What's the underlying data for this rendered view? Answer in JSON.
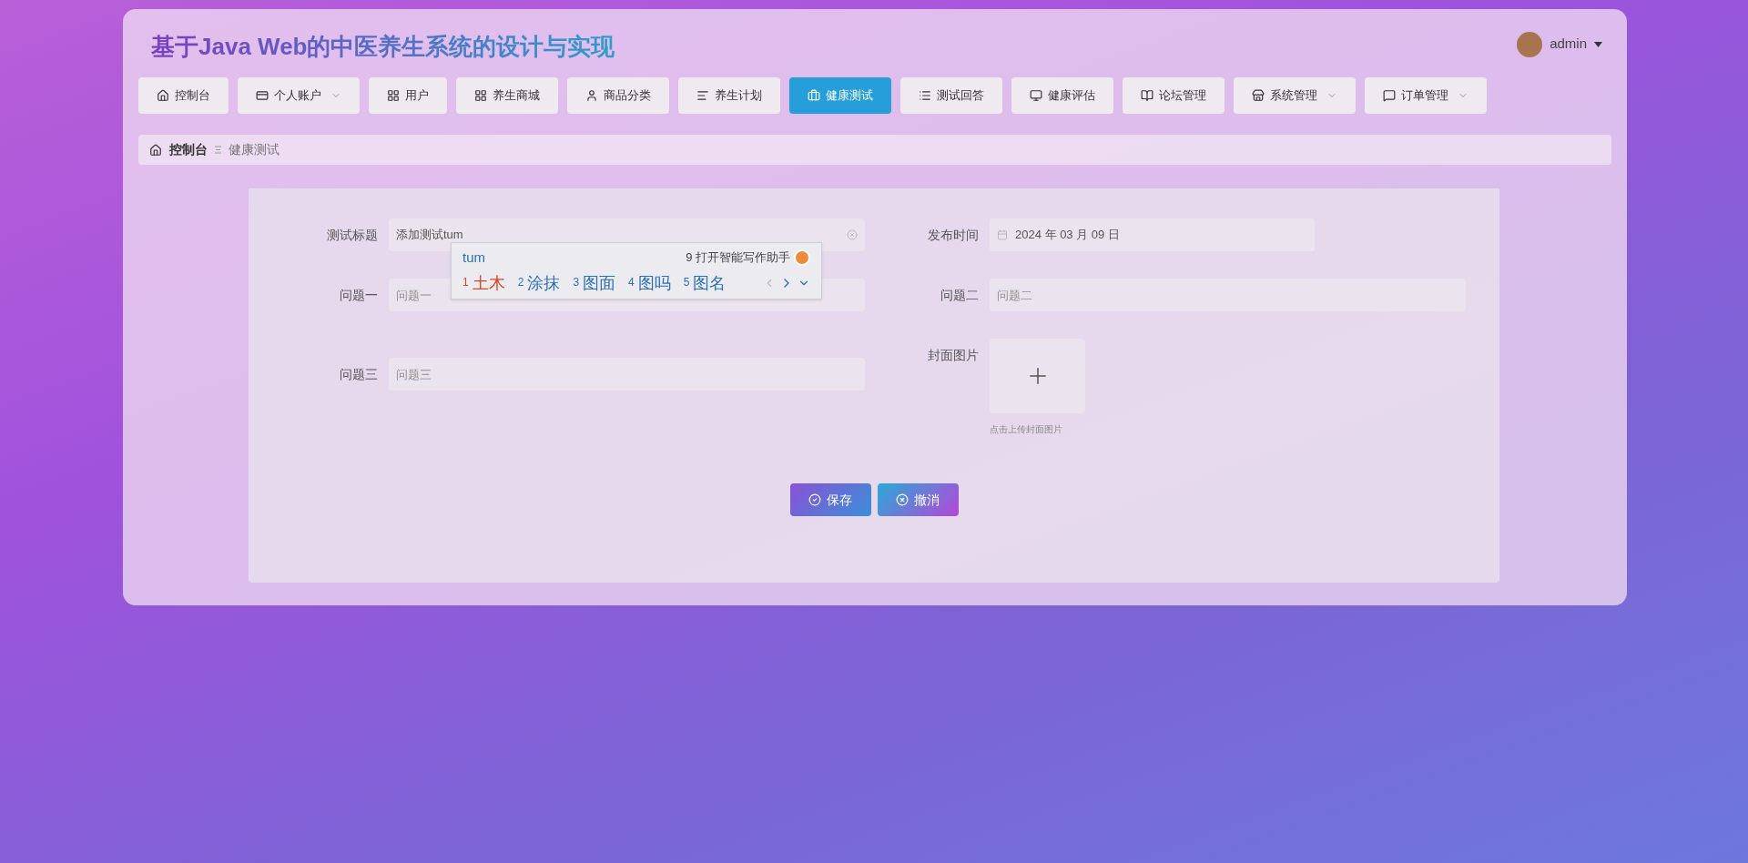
{
  "header": {
    "title": "基于Java Web的中医养生系统的设计与实现",
    "user": {
      "name": "admin"
    }
  },
  "nav": [
    {
      "label": "控制台",
      "dropdown": false,
      "selected": false
    },
    {
      "label": "个人账户",
      "dropdown": true,
      "selected": false
    },
    {
      "label": "用户",
      "dropdown": false,
      "selected": false
    },
    {
      "label": "养生商城",
      "dropdown": false,
      "selected": false
    },
    {
      "label": "商品分类",
      "dropdown": false,
      "selected": false
    },
    {
      "label": "养生计划",
      "dropdown": false,
      "selected": false
    },
    {
      "label": "健康测试",
      "dropdown": false,
      "selected": true
    },
    {
      "label": "测试回答",
      "dropdown": false,
      "selected": false
    },
    {
      "label": "健康评估",
      "dropdown": false,
      "selected": false
    },
    {
      "label": "论坛管理",
      "dropdown": false,
      "selected": false
    },
    {
      "label": "系统管理",
      "dropdown": true,
      "selected": false
    },
    {
      "label": "订单管理",
      "dropdown": true,
      "selected": false
    }
  ],
  "breadcrumb": [
    {
      "label": "控制台"
    },
    {
      "label": "健康测试"
    }
  ],
  "form": {
    "left_fields": [
      {
        "kind": "text",
        "label": "测试标题",
        "value": "添加测试tum"
      },
      {
        "kind": "text",
        "label": "问题一",
        "placeholder": "问题一"
      },
      {
        "kind": "text",
        "label": "问题三",
        "placeholder": "问题三"
      }
    ],
    "right_fields": [
      {
        "kind": "date",
        "label": "发布时间",
        "value": "2024 年 03 月 09 日"
      },
      {
        "kind": "text",
        "label": "问题二",
        "placeholder": "问题二"
      },
      {
        "kind": "upload",
        "label": "封面图片",
        "hint": "点击上传封面图片"
      }
    ],
    "buttons": [
      {
        "kind": "save",
        "label": "保存"
      },
      {
        "kind": "cancel",
        "label": "撤消"
      }
    ]
  },
  "ime": {
    "composition": "tum",
    "assistant": "9 打开智能写作助手",
    "candidates": [
      {
        "number": "1",
        "text": "土木",
        "selected": true
      },
      {
        "number": "2",
        "text": "涂抹",
        "selected": false
      },
      {
        "number": "3",
        "text": "图面",
        "selected": false
      },
      {
        "number": "4",
        "text": "图吗",
        "selected": false
      },
      {
        "number": "5",
        "text": "图名",
        "selected": false
      }
    ]
  }
}
